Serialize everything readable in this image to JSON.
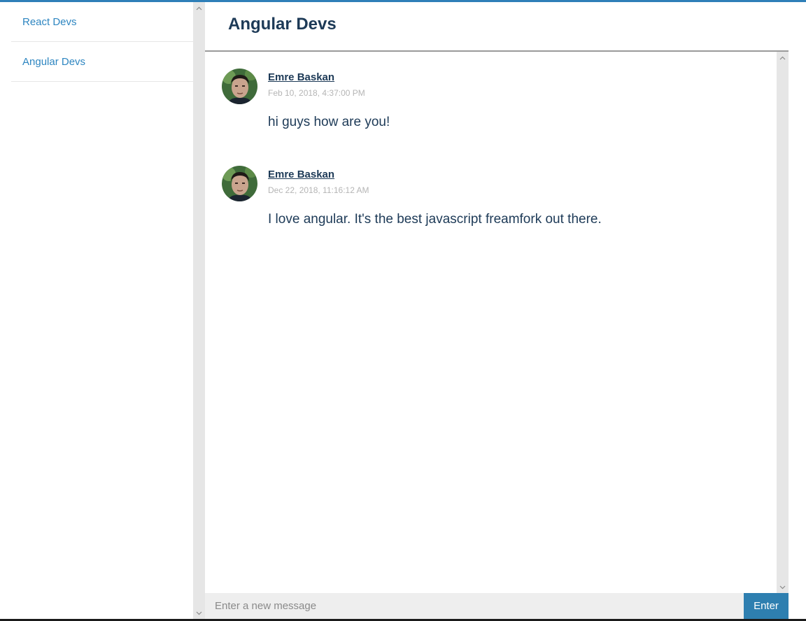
{
  "sidebar": {
    "rooms": [
      {
        "label": "React Devs"
      },
      {
        "label": "Angular Devs"
      }
    ]
  },
  "chat": {
    "title": "Angular Devs",
    "messages": [
      {
        "author": "Emre Baskan",
        "timestamp": "Feb 10, 2018, 4:37:00 PM",
        "text": "hi guys how are you!"
      },
      {
        "author": "Emre Baskan",
        "timestamp": "Dec 22, 2018, 11:16:12 AM",
        "text": "I love angular. It's the best javascript freamfork out there."
      }
    ]
  },
  "composer": {
    "placeholder": "Enter a new message",
    "value": "",
    "button_label": "Enter"
  },
  "colors": {
    "accent": "#2e7fb8",
    "link": "#2e86c1",
    "text": "#1d3a57",
    "timestamp": "#b5b5b5"
  },
  "icons": {
    "scroll_up": "chevron-up-icon",
    "scroll_down": "chevron-down-icon",
    "avatar": "user-avatar"
  }
}
